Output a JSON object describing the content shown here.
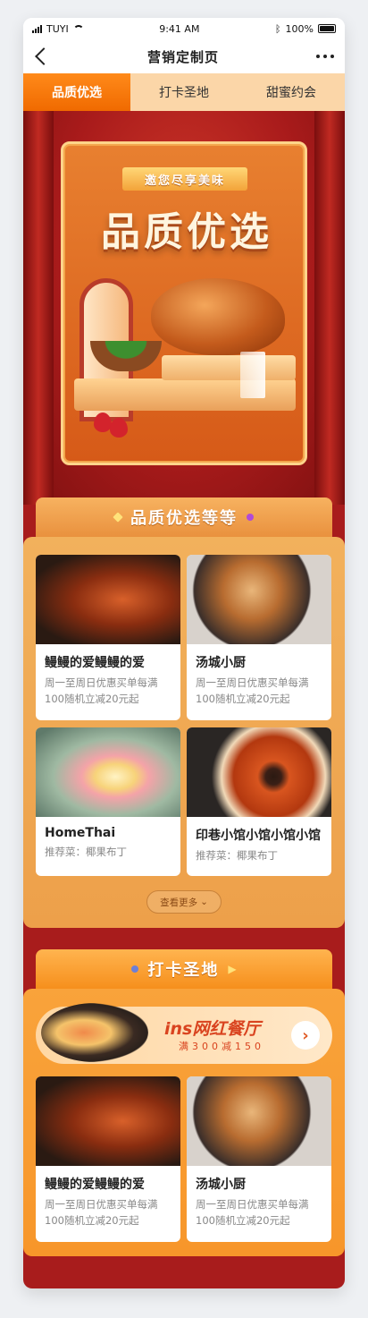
{
  "status_bar": {
    "carrier": "TUYI",
    "time": "9:41 AM",
    "battery": "100%"
  },
  "nav": {
    "title": "营销定制页"
  },
  "tabs": [
    {
      "label": "品质优选",
      "active": true
    },
    {
      "label": "打卡圣地",
      "active": false
    },
    {
      "label": "甜蜜约会",
      "active": false
    }
  ],
  "hero": {
    "badge": "邀您尽享美味",
    "title": "品质优选"
  },
  "section1": {
    "title": "品质优选等等",
    "cards": [
      {
        "name": "鳗鳗的爱鳗鳗的爱",
        "desc": "周一至周日优惠买单每满100随机立减20元起"
      },
      {
        "name": "汤城小厨",
        "desc": "周一至周日优惠买单每满100随机立减20元起"
      },
      {
        "name": "HomeThai",
        "desc": "推荐菜：椰果布丁"
      },
      {
        "name": "印巷小馆小馆小馆小馆",
        "desc": "推荐菜：椰果布丁"
      }
    ],
    "more_label": "查看更多"
  },
  "section2": {
    "title": "打卡圣地",
    "promo": {
      "title": "ins网红餐厅",
      "subtitle": "满300减150",
      "arrow": "›"
    },
    "cards": [
      {
        "name": "鳗鳗的爱鳗鳗的爱",
        "desc": "周一至周日优惠买单每满100随机立减20元起"
      },
      {
        "name": "汤城小厨",
        "desc": "周一至周日优惠买单每满100随机立减20元起"
      }
    ]
  }
}
